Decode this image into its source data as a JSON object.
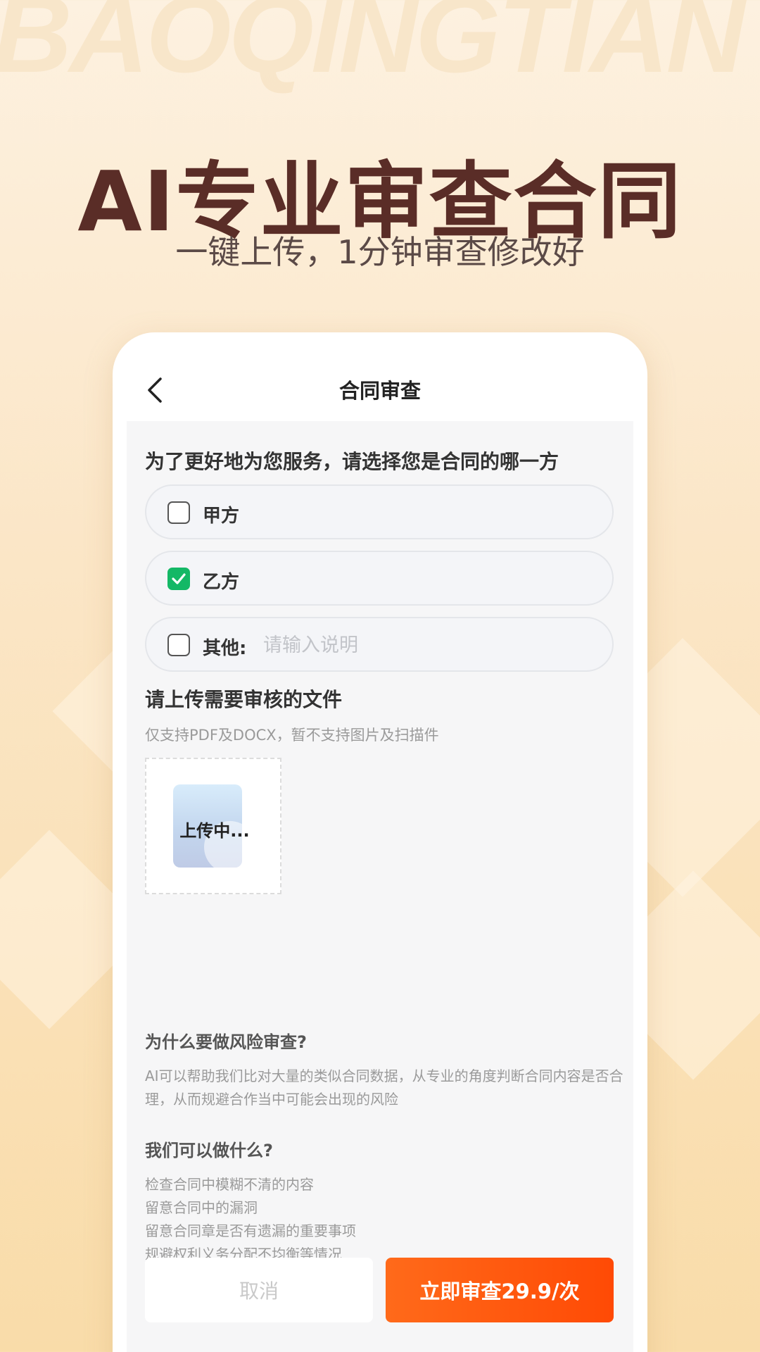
{
  "background": {
    "watermark": "BAOQINGTIAN",
    "accent": "#5a2d27"
  },
  "hero": {
    "title": "AI专业审查合同",
    "subtitle": "一键上传，1分钟审查修改好"
  },
  "app": {
    "nav_title": "合同审查",
    "party_question": "为了更好地为您服务，请选择您是合同的哪一方",
    "options": [
      {
        "label": "甲方",
        "checked": false
      },
      {
        "label": "乙方",
        "checked": true
      },
      {
        "label": "其他:",
        "checked": false,
        "input_placeholder": "请输入说明",
        "input_value": ""
      }
    ],
    "upload": {
      "title": "请上传需要审核的文件",
      "hint": "仅支持PDF及DOCX，暂不支持图片及扫描件",
      "status": "上传中..."
    },
    "why": {
      "title": "为什么要做风险审查?",
      "text": "AI可以帮助我们比对大量的类似合同数据，从专业的角度判断合同内容是否合理，从而规避合作当中可能会出现的风险"
    },
    "can": {
      "title": "我们可以做什么?",
      "items": [
        "检查合同中模糊不清的内容",
        "留意合同中的漏洞",
        "留意合同章是否有遗漏的重要事项",
        "规避权利义务分配不均衡等情况"
      ]
    },
    "buttons": {
      "cancel": "取消",
      "submit": "立即审查29.9/次"
    },
    "colors": {
      "checkbox_checked": "#14b866",
      "primary_button": "#ff5a10"
    }
  }
}
